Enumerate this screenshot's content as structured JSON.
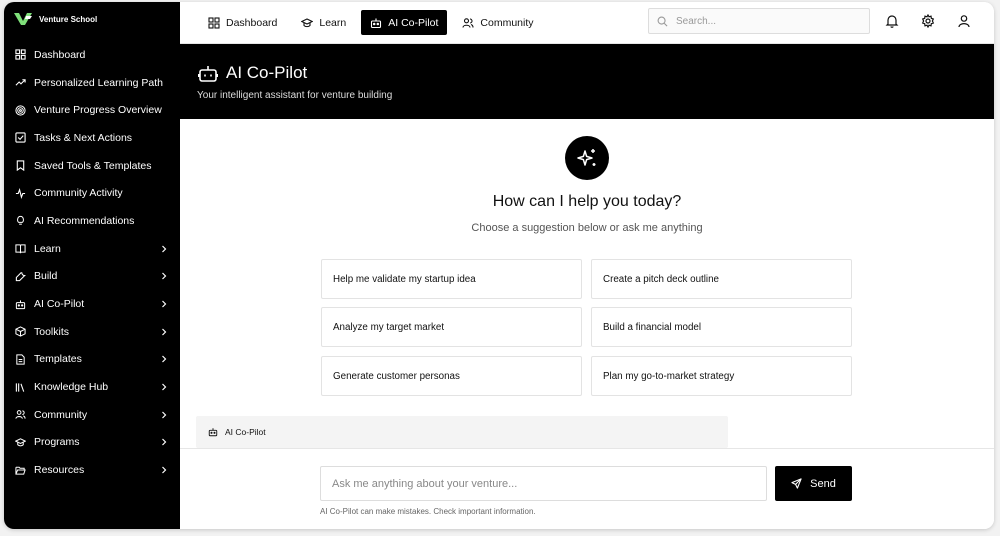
{
  "brand": {
    "name": "Venture School"
  },
  "sidebar": {
    "items": [
      {
        "label": "Dashboard",
        "icon": "grid-icon",
        "chevron": false
      },
      {
        "label": "Personalized Learning Path",
        "icon": "trend-up-icon",
        "chevron": false
      },
      {
        "label": "Venture Progress Overview",
        "icon": "target-icon",
        "chevron": false
      },
      {
        "label": "Tasks & Next Actions",
        "icon": "check-square-icon",
        "chevron": false
      },
      {
        "label": "Saved Tools & Templates",
        "icon": "bookmark-icon",
        "chevron": false
      },
      {
        "label": "Community Activity",
        "icon": "activity-icon",
        "chevron": false
      },
      {
        "label": "AI Recommendations",
        "icon": "lightbulb-icon",
        "chevron": false
      },
      {
        "label": "Learn",
        "icon": "book-open-icon",
        "chevron": true
      },
      {
        "label": "Build",
        "icon": "wrench-icon",
        "chevron": true
      },
      {
        "label": "AI Co-Pilot",
        "icon": "robot-icon",
        "chevron": true
      },
      {
        "label": "Toolkits",
        "icon": "box-icon",
        "chevron": true
      },
      {
        "label": "Templates",
        "icon": "file-text-icon",
        "chevron": true
      },
      {
        "label": "Knowledge Hub",
        "icon": "library-icon",
        "chevron": true
      },
      {
        "label": "Community",
        "icon": "users-icon",
        "chevron": true
      },
      {
        "label": "Programs",
        "icon": "graduation-cap-icon",
        "chevron": true
      },
      {
        "label": "Resources",
        "icon": "folder-open-icon",
        "chevron": true
      }
    ]
  },
  "topnav": {
    "tabs": [
      {
        "label": "Dashboard",
        "icon": "grid-icon"
      },
      {
        "label": "Learn",
        "icon": "graduation-cap-icon"
      },
      {
        "label": "AI Co-Pilot",
        "icon": "robot-icon"
      },
      {
        "label": "Community",
        "icon": "users-icon"
      }
    ],
    "active_tab": "AI Co-Pilot",
    "search_placeholder": "Search..."
  },
  "hero": {
    "title": "AI Co-Pilot",
    "subtitle": "Your intelligent assistant for venture building"
  },
  "main": {
    "headline": "How can I help you today?",
    "subheadline": "Choose a suggestion below or ask me anything",
    "suggestions": [
      "Help me validate my startup idea",
      "Create a pitch deck outline",
      "Analyze my target market",
      "Build a financial model",
      "Generate customer personas",
      "Plan my go-to-market strategy"
    ],
    "assistant_label": "AI Co-Pilot"
  },
  "composer": {
    "placeholder": "Ask me anything about your venture...",
    "send_label": "Send",
    "disclaimer": "AI Co-Pilot can make mistakes. Check important information."
  },
  "colors": {
    "dark": "#000000",
    "accent": "#ffffff"
  }
}
